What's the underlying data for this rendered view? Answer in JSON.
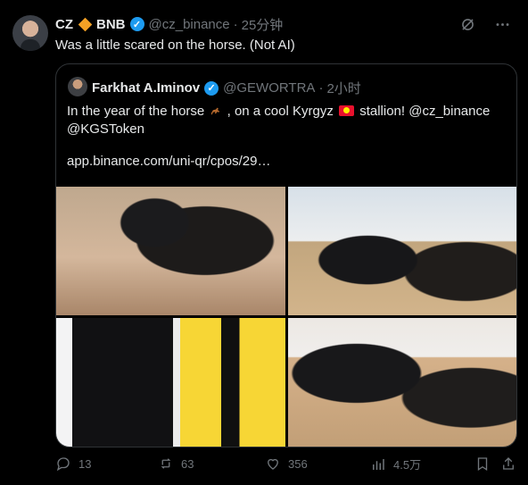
{
  "post": {
    "display_name": "CZ",
    "emoji_name": "diamond-icon",
    "token_name": "BNB",
    "handle": "@cz_binance",
    "separator": "·",
    "time": "25分钟",
    "text": "Was a little scared on the horse. (Not AI)"
  },
  "quote": {
    "display_name": "Farkhat A.Iminov",
    "handle": "@GEWORTRA",
    "separator": "·",
    "time": "2小时",
    "text_line_1_a": "In the year of the horse",
    "text_line_1_b": ", on a cool Kyrgyz",
    "text_line_1_c": "stallion! @cz_binance",
    "text_line_2": "@KGSToken",
    "link": "app.binance.com/uni-qr/cpos/29…"
  },
  "metrics": {
    "replies": "13",
    "reposts": "63",
    "likes": "356",
    "views": "4.5万"
  },
  "colors": {
    "background": "#000000",
    "text": "#e7e9ea",
    "muted": "#71767b",
    "accent": "#1d9bf0",
    "border": "#2f3336"
  }
}
